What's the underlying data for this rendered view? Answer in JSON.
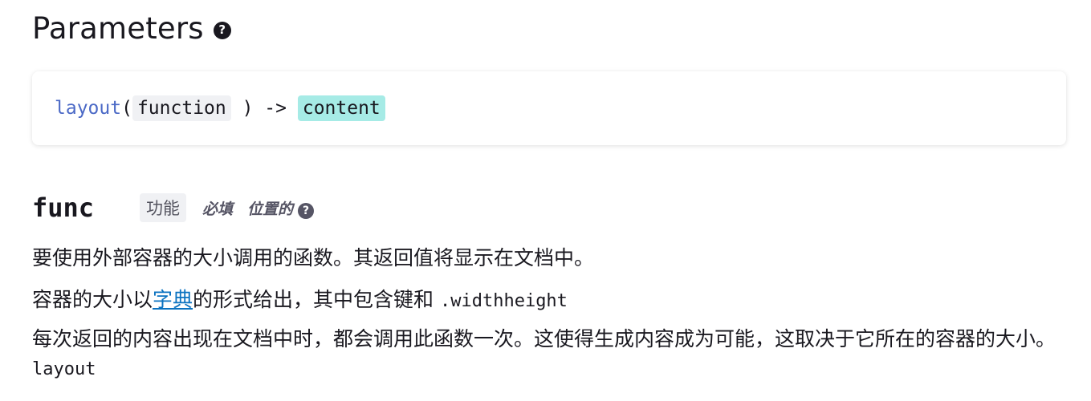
{
  "heading": {
    "title": "Parameters",
    "help_glyph": "?"
  },
  "signature": {
    "function_name": "layout",
    "open_paren": "(",
    "param_type": "function",
    "close_arrow": ") ->",
    "return_type": "content"
  },
  "param": {
    "name": "func",
    "type": "功能",
    "required": "必填",
    "positional": "位置的",
    "help_glyph": "?"
  },
  "description": {
    "line1": "要使用外部容器的大小调用的函数。其返回值将显示在文档中。",
    "line2_prefix": "容器的大小以",
    "line2_link": "字典",
    "line2_middle": "的形式给出，其中包含键和 ",
    "line2_code": ".widthheight",
    "line3_text": "每次返回的内容出现在文档中时，都会调用此函数一次。这使得生成内容成为可能，这取决于它所在的容器的大小。",
    "line3_code": "layout"
  },
  "colors": {
    "function_name": "#4b69c6",
    "content_type_bg": "#a6ebe6",
    "type_pill_bg": "#f0f1f4",
    "link": "#0a72c0"
  }
}
